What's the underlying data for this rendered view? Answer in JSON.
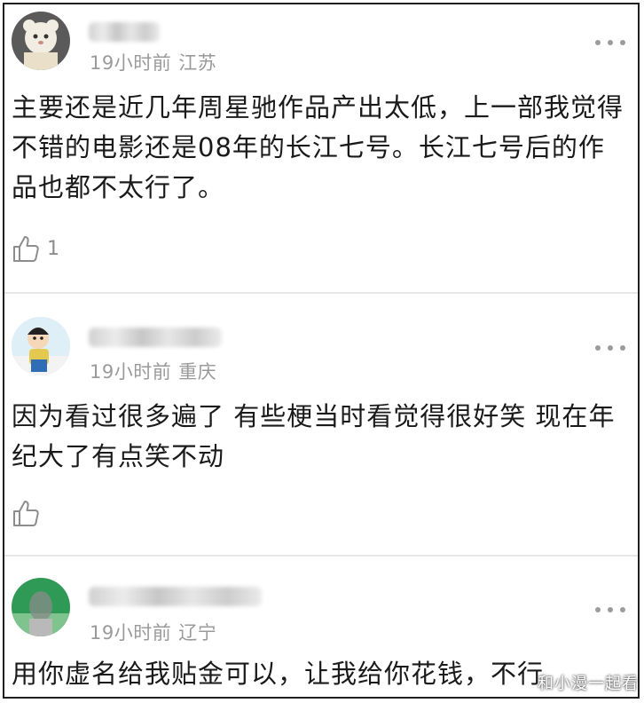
{
  "comments": [
    {
      "time": "19小时前",
      "location": "江苏",
      "text": "主要还是近几年周星驰作品产出太低，上一部我觉得不错的电影还是08年的长江七号。长江七号后的作品也都不太行了。",
      "likes": "1"
    },
    {
      "time": "19小时前",
      "location": "重庆",
      "text": "因为看过很多遍了 有些梗当时看觉得很好笑 现在年纪大了有点笑不动",
      "likes": ""
    },
    {
      "time": "19小时前",
      "location": "辽宁",
      "text": "用你虚名给我贴金可以，让我给你花钱，不行"
    }
  ],
  "icons": {
    "more": "more-dots-icon",
    "like": "thumbs-up-icon"
  },
  "watermark": "和小漫一起看",
  "colors": {
    "meta": "#9a9a9a",
    "text": "#1a1a1a",
    "divider": "#e7e7e7"
  }
}
